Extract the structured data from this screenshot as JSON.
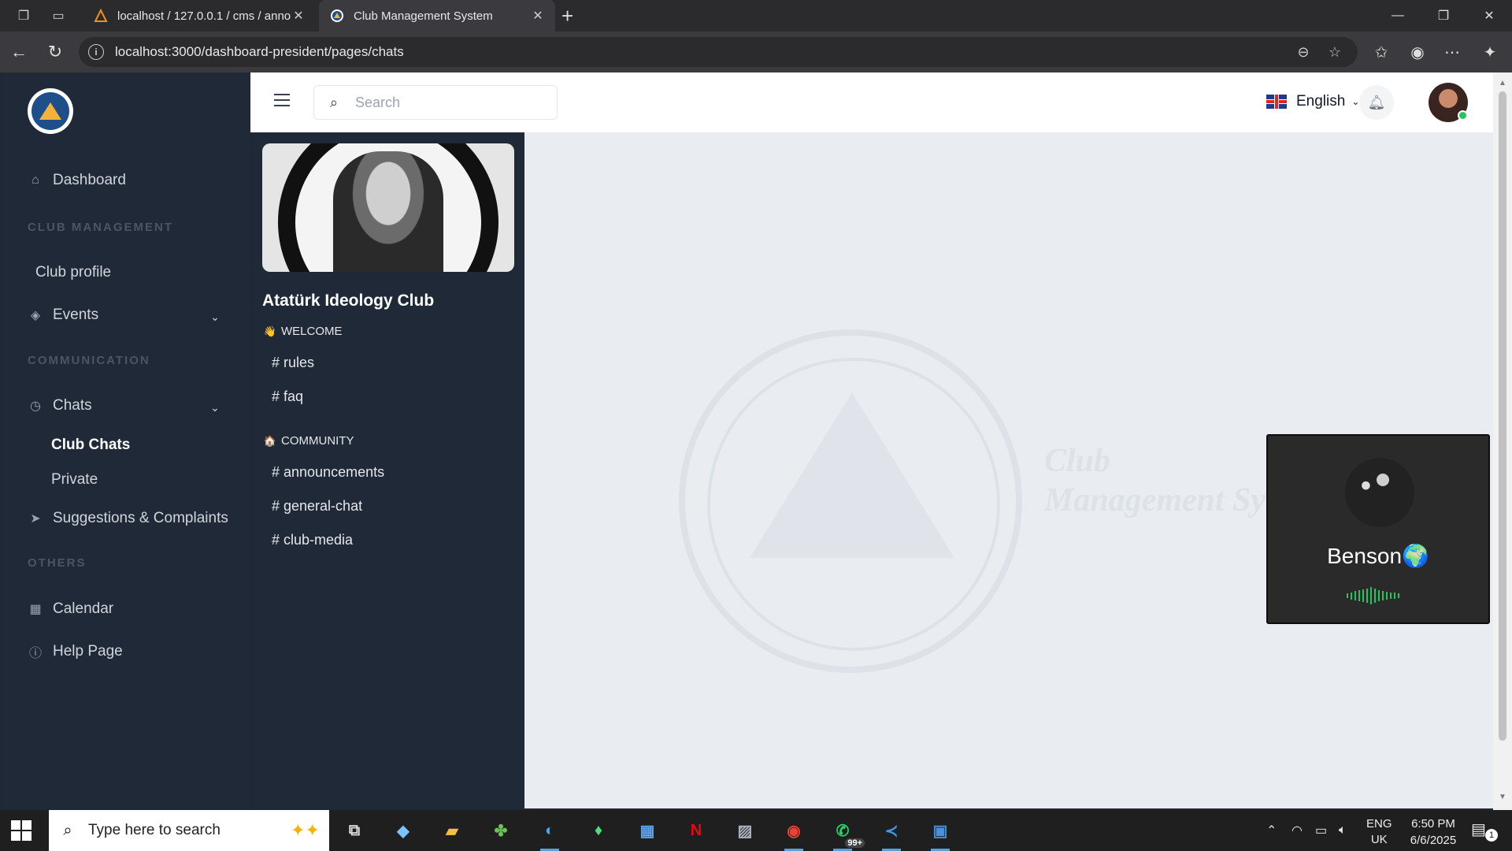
{
  "browser": {
    "tabs": [
      {
        "title": "localhost / 127.0.0.1 / cms / anno",
        "active": false
      },
      {
        "title": "Club Management System",
        "active": true
      }
    ],
    "url": "localhost:3000/dashboard-president/pages/chats"
  },
  "sidebar": {
    "items": {
      "dashboard": "Dashboard",
      "section_club": "CLUB MANAGEMENT",
      "club_profile": "Club profile",
      "events": "Events",
      "section_comm": "COMMUNICATION",
      "chats": "Chats",
      "club_chats": "Club Chats",
      "private": "Private",
      "suggestions": "Suggestions & Complaints",
      "section_others": "OTHERS",
      "calendar": "Calendar",
      "help": "Help Page"
    }
  },
  "topbar": {
    "search_placeholder": "Search",
    "language": "English"
  },
  "club": {
    "name": "Atatürk Ideology Club",
    "categories": [
      {
        "name": "WELCOME",
        "icon": "waving-hand-icon",
        "channels": [
          "# rules",
          "# faq"
        ]
      },
      {
        "name": "COMMUNITY",
        "icon": "house-icon",
        "channels": [
          "# announcements",
          "# general-chat",
          "# club-media"
        ]
      }
    ]
  },
  "watermark": {
    "text_line1": "Club",
    "text_line2": "Management Sy"
  },
  "call": {
    "user_name": "Benson🌍",
    "speaking": true
  },
  "taskbar": {
    "search_text": "Type here to search",
    "whatsapp_badge": "99+",
    "lang_line1": "ENG",
    "lang_line2": "UK",
    "time": "6:50 PM",
    "date": "6/6/2025",
    "notification_count": "1"
  },
  "colors": {
    "sidebar_bg": "#1f2937",
    "main_bg": "#e9edf2",
    "online": "#22c55e",
    "call_bg": "#2a2a2a"
  }
}
